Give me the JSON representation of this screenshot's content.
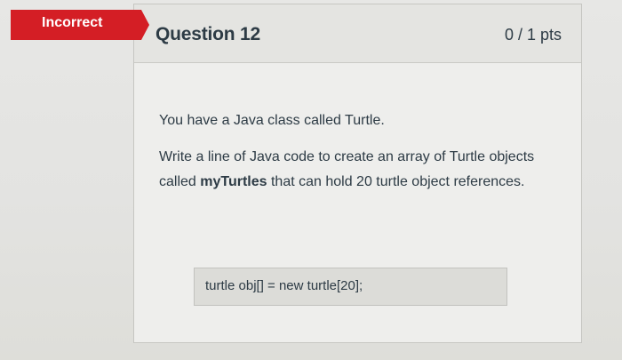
{
  "badge": {
    "label": "Incorrect",
    "color": "#d41e25"
  },
  "question": {
    "title": "Question 12",
    "points": "0 / 1 pts",
    "intro": "You have a Java class called Turtle.",
    "prompt_before": "Write a line of Java code to create an array of Turtle objects called ",
    "prompt_emphasis": "myTurtles",
    "prompt_after": " that can hold 20 turtle object references."
  },
  "answer": {
    "value": "turtle obj[] = new turtle[20];"
  },
  "colors": {
    "text": "#2d3b45",
    "card_bg": "#eeeeec",
    "header_bg": "#e4e4e1",
    "answer_bg": "#dcdcd8"
  }
}
